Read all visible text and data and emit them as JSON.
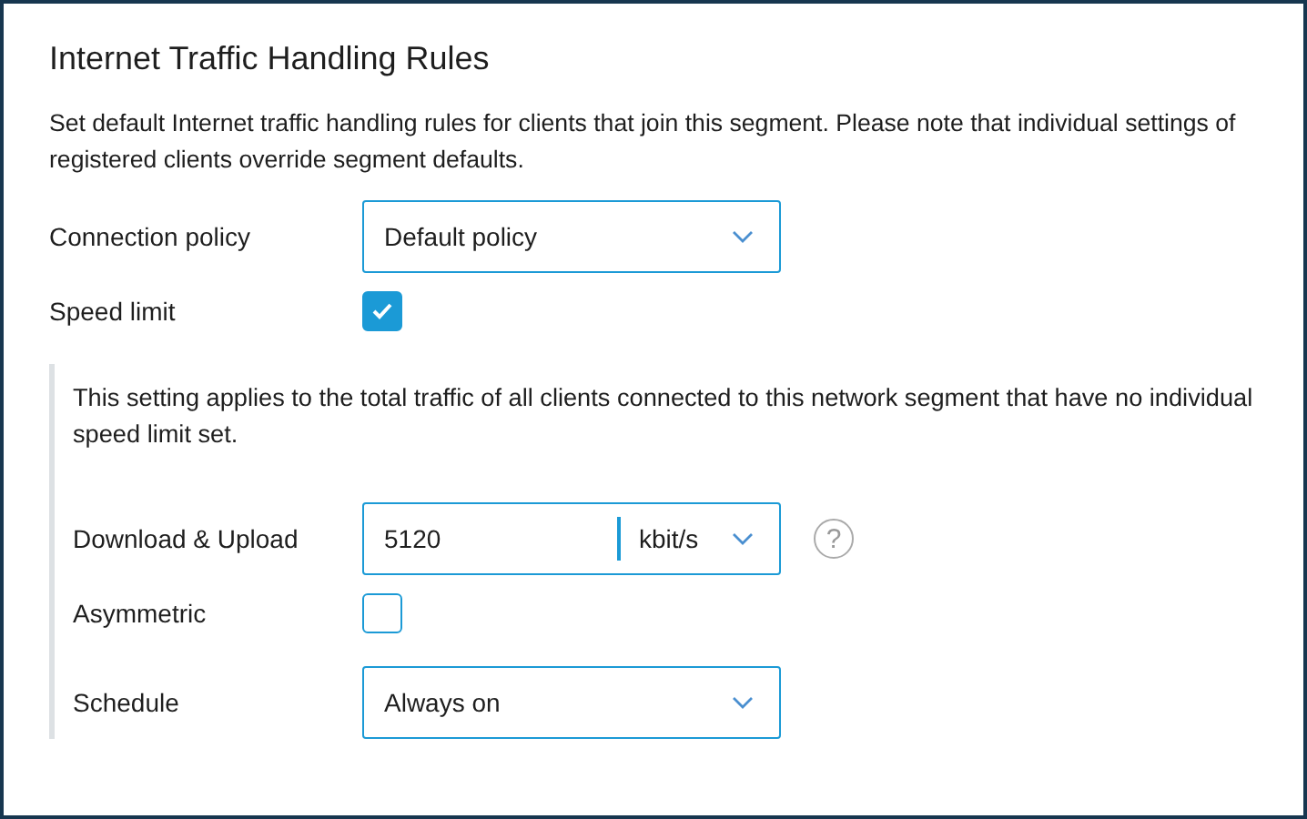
{
  "title": "Internet Traffic Handling Rules",
  "description": "Set default Internet traffic handling rules for clients that join this segment. Please note that individual settings of registered clients override segment defaults.",
  "rows": [
    {
      "kind": "select",
      "label": "Connection policy",
      "value": "Default policy"
    },
    {
      "kind": "checkbox",
      "label": "Speed limit",
      "checked": true
    }
  ],
  "speed_limit": {
    "note": "This setting applies to the total traffic of all clients connected to this network segment that have no individual speed limit set.",
    "rows": [
      {
        "kind": "unit_input",
        "label": "Download & Upload",
        "value": "5120",
        "unit": "kbit/s",
        "help": "?"
      },
      {
        "kind": "checkbox",
        "label": "Asymmetric",
        "checked": false
      },
      {
        "kind": "select",
        "label": "Schedule",
        "value": "Always on"
      }
    ]
  }
}
